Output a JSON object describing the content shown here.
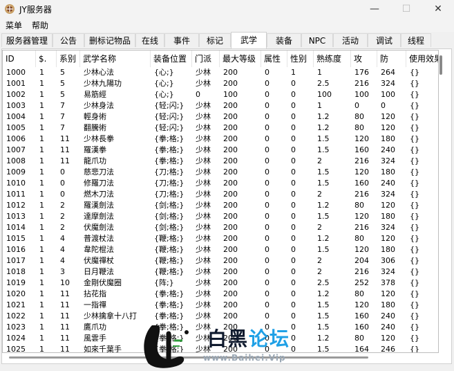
{
  "window": {
    "title": "JY服务器",
    "minimize": "—",
    "maximize": "☐",
    "close": "✕"
  },
  "menu": [
    "菜单",
    "帮助"
  ],
  "tabs": [
    "服务器管理",
    "公告",
    "删标记物品",
    "在线",
    "事件",
    "标记",
    "武学",
    "装备",
    "NPC",
    "活动",
    "调试",
    "线程"
  ],
  "active_tab": "武学",
  "table": {
    "columns": [
      "ID",
      "$.",
      "系别",
      "武学名称",
      "装备位置",
      "门派",
      "最大等级",
      "属性",
      "性别",
      "熟练度",
      "攻",
      "防",
      "使用效果"
    ],
    "rows": [
      [
        "1000",
        "1",
        "5",
        "少林心法",
        "{心;}",
        "少林",
        "200",
        "0",
        "1",
        "1",
        "176",
        "264",
        "{}"
      ],
      [
        "1001",
        "1",
        "5",
        "少林九陽功",
        "{心;}",
        "少林",
        "200",
        "0",
        "0",
        "2.5",
        "216",
        "324",
        "{}"
      ],
      [
        "1002",
        "1",
        "5",
        "易筋經",
        "{心;}",
        "0",
        "100",
        "0",
        "0",
        "100",
        "100",
        "100",
        "{}"
      ],
      [
        "1003",
        "1",
        "7",
        "少林身法",
        "{轻;闪;}",
        "少林",
        "200",
        "0",
        "0",
        "1",
        "0",
        "0",
        "{}"
      ],
      [
        "1004",
        "1",
        "7",
        "輕身術",
        "{轻;闪;}",
        "少林",
        "200",
        "0",
        "0",
        "1.2",
        "80",
        "120",
        "{}"
      ],
      [
        "1005",
        "1",
        "7",
        "翻騰術",
        "{轻;闪;}",
        "少林",
        "200",
        "0",
        "0",
        "1.2",
        "80",
        "120",
        "{}"
      ],
      [
        "1006",
        "1",
        "11",
        "少林長拳",
        "{拳;格;}",
        "少林",
        "200",
        "0",
        "0",
        "1.5",
        "120",
        "180",
        "{}"
      ],
      [
        "1007",
        "1",
        "11",
        "羅漢拳",
        "{拳;格;}",
        "少林",
        "200",
        "0",
        "0",
        "1.5",
        "160",
        "240",
        "{}"
      ],
      [
        "1008",
        "1",
        "11",
        "龍爪功",
        "{拳;格;}",
        "少林",
        "200",
        "0",
        "0",
        "2",
        "216",
        "324",
        "{}"
      ],
      [
        "1009",
        "1",
        "0",
        "慈悲刀法",
        "{刀;格;}",
        "少林",
        "200",
        "0",
        "0",
        "1.5",
        "120",
        "180",
        "{}"
      ],
      [
        "1010",
        "1",
        "0",
        "修羅刀法",
        "{刀;格;}",
        "少林",
        "200",
        "0",
        "0",
        "1.5",
        "160",
        "240",
        "{}"
      ],
      [
        "1011",
        "1",
        "0",
        "燃木刀法",
        "{刀;格;}",
        "少林",
        "200",
        "0",
        "0",
        "2",
        "216",
        "324",
        "{}"
      ],
      [
        "1012",
        "1",
        "2",
        "羅漢劍法",
        "{剑;格;}",
        "少林",
        "200",
        "0",
        "0",
        "1.2",
        "80",
        "120",
        "{}"
      ],
      [
        "1013",
        "1",
        "2",
        "達摩劍法",
        "{剑;格;}",
        "少林",
        "200",
        "0",
        "0",
        "1.5",
        "120",
        "180",
        "{}"
      ],
      [
        "1014",
        "1",
        "2",
        "伏魔劍法",
        "{剑;格;}",
        "少林",
        "200",
        "0",
        "0",
        "2",
        "216",
        "324",
        "{}"
      ],
      [
        "1015",
        "1",
        "4",
        "普渡杖法",
        "{鞭;格;}",
        "少林",
        "200",
        "0",
        "0",
        "1.2",
        "80",
        "120",
        "{}"
      ],
      [
        "1016",
        "1",
        "4",
        "韋陀棍法",
        "{鞭;格;}",
        "少林",
        "200",
        "0",
        "0",
        "1.5",
        "120",
        "180",
        "{}"
      ],
      [
        "1017",
        "1",
        "4",
        "伏魔禪杖",
        "{鞭;格;}",
        "少林",
        "200",
        "0",
        "0",
        "2",
        "204",
        "306",
        "{}"
      ],
      [
        "1018",
        "1",
        "3",
        "日月鞭法",
        "{鞭;格;}",
        "少林",
        "200",
        "0",
        "0",
        "2",
        "216",
        "324",
        "{}"
      ],
      [
        "1019",
        "1",
        "10",
        "金剛伏魔圈",
        "{阵;}",
        "少林",
        "200",
        "0",
        "0",
        "2.5",
        "252",
        "378",
        "{}"
      ],
      [
        "1020",
        "1",
        "11",
        "拈花指",
        "{拳;格;}",
        "少林",
        "200",
        "0",
        "0",
        "1.2",
        "80",
        "120",
        "{}"
      ],
      [
        "1021",
        "1",
        "11",
        "一指禪",
        "{拳;格;}",
        "少林",
        "200",
        "0",
        "0",
        "1.5",
        "120",
        "180",
        "{}"
      ],
      [
        "1022",
        "1",
        "11",
        "少林擒拿十八打",
        "{拳;格;}",
        "少林",
        "200",
        "0",
        "0",
        "1.5",
        "160",
        "240",
        "{}"
      ],
      [
        "1023",
        "1",
        "11",
        "鷹爪功",
        "{拳;格;}",
        "少林",
        "200",
        "0",
        "0",
        "1.5",
        "160",
        "240",
        "{}"
      ],
      [
        "1024",
        "1",
        "11",
        "風雲手",
        "{拳;格;}",
        "少林",
        "200",
        "0",
        "0",
        "1.2",
        "80",
        "120",
        "{}"
      ],
      [
        "1025",
        "1",
        "11",
        "如來千葉手",
        "{拳;格;}",
        "少林",
        "200",
        "0",
        "0",
        "1.5",
        "164",
        "246",
        "{}"
      ]
    ]
  },
  "watermark": {
    "title_a": "白黑",
    "title_b": "论坛",
    "url": "www.Baihei.Vip"
  },
  "colors": {
    "watermark_dark": "#0f1a2e",
    "watermark_blue": "#1fa0e6"
  }
}
